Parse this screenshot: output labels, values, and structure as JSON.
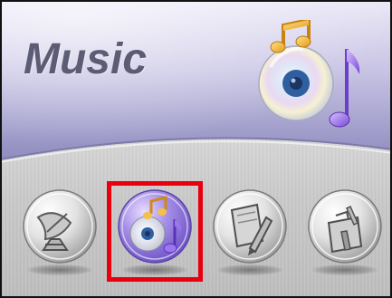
{
  "header": {
    "title": "Music",
    "icon": "music-cd-note-icon"
  },
  "menu": {
    "selected_index": 1,
    "items": [
      {
        "name": "satellite-dish-icon"
      },
      {
        "name": "music-cd-note-icon"
      },
      {
        "name": "notepad-pen-icon"
      },
      {
        "name": "toolbox-tools-icon"
      }
    ]
  },
  "colors": {
    "header_purple_light": "#e4e1f3",
    "header_purple_dark": "#8c8abf",
    "title_text": "#5c5d75",
    "selected_button_purple": "#8b73d6",
    "selection_highlight": "#e8000e",
    "background_gray": "#c9c9c9"
  }
}
